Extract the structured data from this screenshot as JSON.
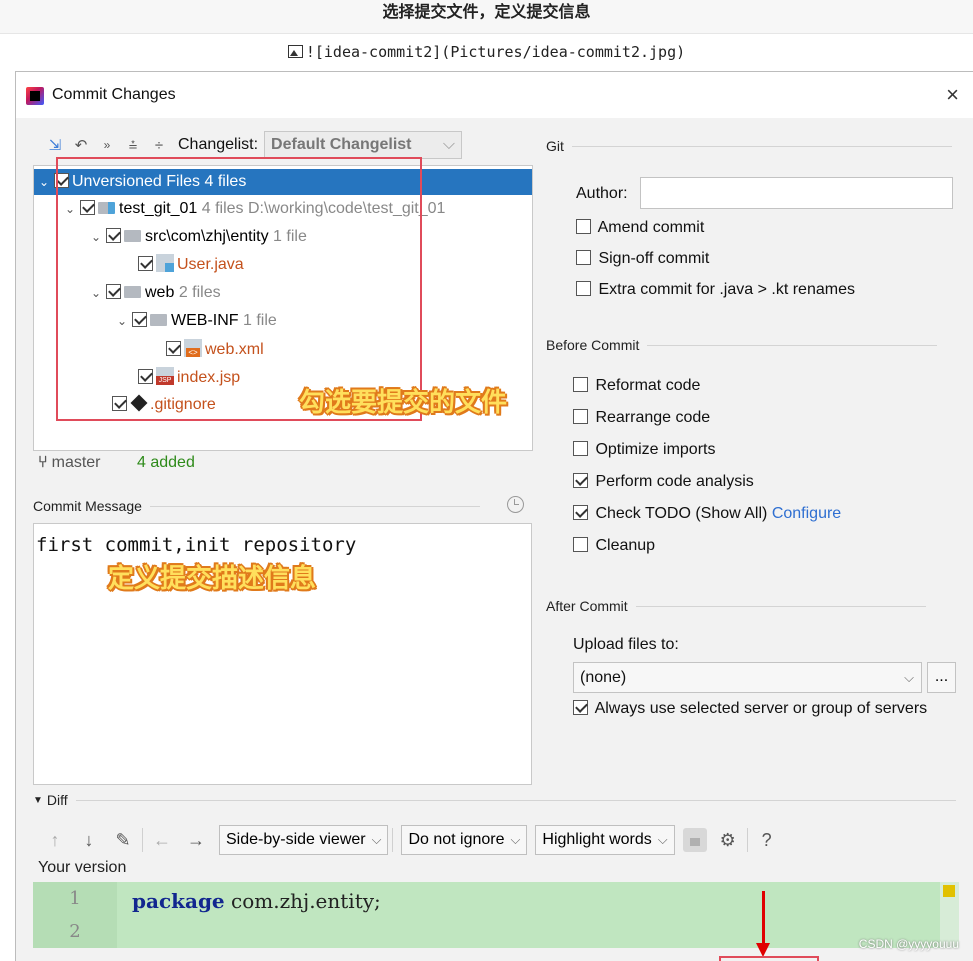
{
  "page_heading": "选择提交文件，定义提交信息",
  "image_caption": "![idea-commit2](Pictures/idea-commit2.jpg)",
  "dialog": {
    "title": "Commit Changes",
    "close": "×"
  },
  "toolbar": {
    "changelist_label": "Changelist:",
    "changelist_value": "Default Changelist"
  },
  "tree": {
    "root": {
      "label": "Unversioned Files",
      "count": "4 files"
    },
    "project": {
      "label": "test_git_01",
      "count": "4 files",
      "path": "D:\\working\\code\\test_git_01"
    },
    "src": {
      "label": "src\\com\\zhj\\entity",
      "count": "1 file"
    },
    "user_java": {
      "label": "User.java"
    },
    "web": {
      "label": "web",
      "count": "2 files"
    },
    "webinf": {
      "label": "WEB-INF",
      "count": "1 file"
    },
    "web_xml": {
      "label": "web.xml"
    },
    "index_jsp": {
      "label": "index.jsp"
    },
    "gitignore": {
      "label": ".gitignore"
    }
  },
  "annotations": {
    "select_files": "勾选要提交的文件",
    "define_message": "定义提交描述信息"
  },
  "status": {
    "branch": "master",
    "added": "4 added"
  },
  "commit_message": {
    "title": "Commit Message",
    "text": "first commit,init repository"
  },
  "git": {
    "title": "Git",
    "author_label": "Author:",
    "author_value": "",
    "amend": "Amend commit",
    "signoff": "Sign-off commit",
    "extra": "Extra commit for .java > .kt renames"
  },
  "before_commit": {
    "title": "Before Commit",
    "reformat": "Reformat code",
    "rearrange": "Rearrange code",
    "optimize": "Optimize imports",
    "analysis": "Perform code analysis",
    "todo": "Check TODO (Show All)",
    "todo_link": "Configure",
    "cleanup": "Cleanup"
  },
  "after_commit": {
    "title": "After Commit",
    "upload_label": "Upload files to:",
    "upload_value": "(none)",
    "more": "...",
    "always": "Always use selected server or group of servers"
  },
  "diff": {
    "title": "Diff",
    "viewer": "Side-by-side viewer",
    "ignore": "Do not ignore",
    "highlight": "Highlight words",
    "help": "?",
    "your_version": "Your version",
    "line1_no": "1",
    "line2_no": "2",
    "line1_keyword": "package",
    "line1_rest": " com.zhj.entity;"
  },
  "watermark": "CSDN @yyyyouuu",
  "colors": {
    "selection": "#2675bf",
    "unversioned_file": "#c4511c",
    "added": "#2e8b1a",
    "annotation_box": "#e04b5a",
    "diff_added_bg": "#c0e6c0",
    "link": "#2f6fd1"
  }
}
